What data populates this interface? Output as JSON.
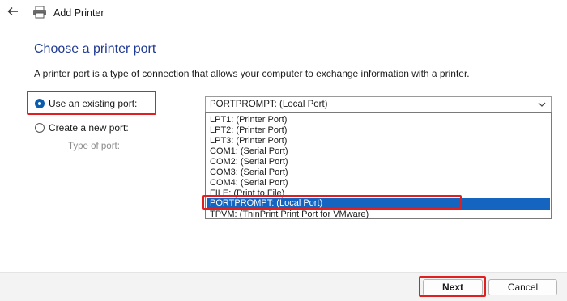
{
  "window": {
    "title": "Add Printer",
    "back_icon": "back-arrow-icon",
    "app_icon": "printer-icon"
  },
  "page": {
    "heading": "Choose a printer port",
    "description": "A printer port is a type of connection that allows your computer to exchange information with a printer."
  },
  "options": {
    "existing_port": {
      "label": "Use an existing port:",
      "selected": true
    },
    "new_port": {
      "label": "Create a new port:",
      "selected": false
    },
    "type_of_port_label": "Type of port:"
  },
  "port_select": {
    "value": "PORTPROMPT: (Local Port)",
    "items": [
      "LPT1: (Printer Port)",
      "LPT2: (Printer Port)",
      "LPT3: (Printer Port)",
      "COM1: (Serial Port)",
      "COM2: (Serial Port)",
      "COM3: (Serial Port)",
      "COM4: (Serial Port)",
      "FILE: (Print to File)",
      "PORTPROMPT: (Local Port)",
      "TPVM: (ThinPrint Print Port for VMware)"
    ],
    "selected_index": 8
  },
  "footer": {
    "next_label": "Next",
    "cancel_label": "Cancel"
  },
  "colors": {
    "heading": "#1f3a93",
    "accent": "#1565c0",
    "highlight_box": "#e02020"
  }
}
